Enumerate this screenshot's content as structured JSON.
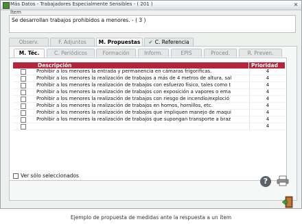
{
  "window": {
    "title": "Más Datos - Trabajadores Especialmente Sensibles - ( 201 )",
    "close_label": "×"
  },
  "item": {
    "label": "Ítem",
    "text": "Se desarrollan trabajos prohibidos a menores. - ( 3 )"
  },
  "main_tabs": [
    {
      "label": "Observ."
    },
    {
      "label": "F. Adjuntos"
    },
    {
      "label": "M. Propuestas"
    },
    {
      "label": "C. Referencia"
    }
  ],
  "sub_tabs": [
    {
      "label": "M. Téc."
    },
    {
      "label": "C. Periódicos"
    },
    {
      "label": "Formación"
    },
    {
      "label": "Inform."
    },
    {
      "label": "EPIS"
    },
    {
      "label": "Proced."
    },
    {
      "label": "R. Preven."
    }
  ],
  "table": {
    "headers": {
      "description": "Descripción",
      "priority": "Prioridad"
    },
    "rows": [
      {
        "description": "Prohibir a los menores la entrada y permanencia en cámaras frigoríficas.",
        "priority": "4"
      },
      {
        "description": "Prohibir a los menores la realización de trabajos a más de 4 metros de altura, sal",
        "priority": "4"
      },
      {
        "description": "Prohibir a los menores la realización de trabajos con esfuerzo físico, tales como t",
        "priority": "4"
      },
      {
        "description": "Prohibir a los menores la realización de trabajos con exposición a vapores o ema",
        "priority": "4"
      },
      {
        "description": "Prohibir a los menores la realización de trabajos con riesgo de incendio/exploció",
        "priority": "4"
      },
      {
        "description": "Prohibir a los menores la realización de trabajos en hornos, hornillos, etc.",
        "priority": "4"
      },
      {
        "description": "Prohibir a los menores la realización de trabajos que impliquen manejo de maqui",
        "priority": "4"
      },
      {
        "description": "Prohibir a los menores la realización de trabajos que supongan transporte a braz",
        "priority": "4"
      },
      {
        "description": "",
        "priority": "4"
      }
    ]
  },
  "filter": {
    "label": "Ver sólo seleccionados"
  },
  "help_label": "?",
  "caption": "Ejemplo de propuesta de medidas ante la respuesta a un ítem",
  "colors": {
    "header": "#b3253a",
    "check": "#3a9d3a"
  }
}
